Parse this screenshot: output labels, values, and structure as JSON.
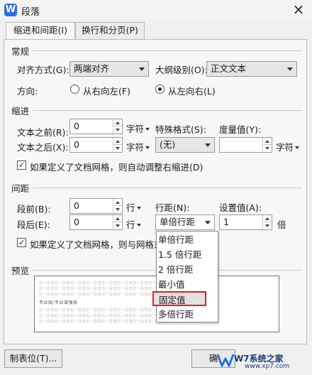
{
  "window": {
    "title": "段落",
    "app_icon": "W"
  },
  "tabs": [
    {
      "label": "缩进和间距(I)",
      "active": true
    },
    {
      "label": "换行和分页(P)",
      "active": false
    }
  ],
  "general": {
    "section_label": "常规",
    "alignment_label": "对齐方式(G):",
    "alignment_value": "两端对齐",
    "outline_label": "大纲级别(O):",
    "outline_value": "正文文本",
    "direction_label": "方向:",
    "rtl_label": "从右向左(F)",
    "ltr_label": "从左向右(L)",
    "direction_selected": "ltr"
  },
  "indent": {
    "section_label": "缩进",
    "before_label": "文本之前(R):",
    "before_value": "0",
    "before_unit": "字符",
    "after_label": "文本之后(X):",
    "after_value": "0",
    "after_unit": "字符",
    "special_label": "特殊格式(S):",
    "special_value": "(无)",
    "measure_label": "度量值(Y):",
    "measure_value": "",
    "measure_unit": "字符",
    "grid_checkbox": "如果定义了文档网格，则自动调整右缩进(D)",
    "grid_checked": true
  },
  "spacing": {
    "section_label": "间距",
    "before_label": "段前(B):",
    "before_value": "0",
    "before_unit": "行",
    "after_label": "段后(E):",
    "after_value": "0",
    "after_unit": "行",
    "line_label": "行距(N):",
    "line_value": "单倍行距",
    "setting_label": "设置值(A):",
    "setting_value": "1",
    "setting_unit": "倍",
    "grid_checkbox": "如果定义了文档网格，则与网格对齐",
    "grid_checked": true
  },
  "line_spacing_menu": {
    "options": [
      "单倍行距",
      "1.5 倍行距",
      "2 倍行距",
      "最小值",
      "固定值",
      "多倍行距"
    ],
    "highlighted": "固定值"
  },
  "preview": {
    "section_label": "预览",
    "sample_prev": "前一段落前一段落前一段落前一段落前一段落前一段落前一段落前一段落前一段落前一段落",
    "sample_text": "专业版/专业增强版",
    "sample_next": "后一段落后一段落后一段落后一段落后一段落后一段落后一段落后一段落后一段落后一段落"
  },
  "footer": {
    "tabs_button": "制表位(T)...",
    "ok_button": "确"
  },
  "watermark": {
    "text": "W7系统之家",
    "url": "www.xp7.com"
  },
  "colors": {
    "accent": "#2e6de8",
    "highlight_border": "#e02020"
  }
}
